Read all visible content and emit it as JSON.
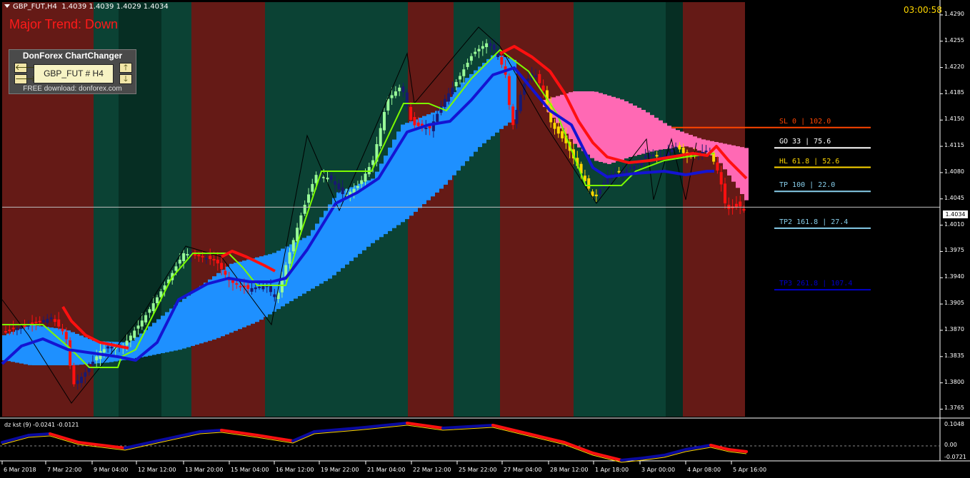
{
  "header": {
    "symbol_line": "GBP_FUT,H4  1.4039 1.4039 1.4029 1.4034",
    "countdown": "03:00:58",
    "trend_text": "Major Trend: Down"
  },
  "widget": {
    "title": "DonForex ChartChanger",
    "symbol_button": "GBP_FUT # H4",
    "footer": "FREE download:  donforex.com",
    "left_up": "🡐",
    "left_down": "🡒",
    "right_up": "🡑",
    "right_down": "🡓"
  },
  "fib_levels": [
    {
      "label": "SL  0      | 102.0",
      "color": "#ff4500",
      "price": 1.414
    },
    {
      "label": "GO  33     | 75.6",
      "color": "#ffffff",
      "price": 1.4113
    },
    {
      "label": "HL  61.8   | 52.6",
      "color": "#ffd700",
      "price": 1.4087
    },
    {
      "label": "TP  100    | 22.0",
      "color": "#87ceeb",
      "price": 1.4055
    },
    {
      "label": "TP2  161.8  | 27.4",
      "color": "#87ceeb",
      "price": 1.4006
    },
    {
      "label": "TP3  261.8  | 107.4",
      "color": "#0000cd",
      "price": 1.3924
    }
  ],
  "y_axis": {
    "ticks": [
      "1.4290",
      "1.4255",
      "1.4220",
      "1.4185",
      "1.4150",
      "1.4115",
      "1.4080",
      "1.4045",
      "1.4010",
      "1.3975",
      "1.3940",
      "1.3905",
      "1.3870",
      "1.3835",
      "1.3800",
      "1.3765"
    ],
    "current_price": "1.4034"
  },
  "x_axis": {
    "ticks": [
      "6 Mar 2018",
      "7 Mar 22:00",
      "9 Mar 04:00",
      "12 Mar 12:00",
      "13 Mar 20:00",
      "15 Mar 04:00",
      "16 Mar 12:00",
      "19 Mar 22:00",
      "21 Mar 04:00",
      "22 Mar 12:00",
      "25 Mar 22:00",
      "27 Mar 04:00",
      "28 Mar 12:00",
      "1 Apr 18:00",
      "3 Apr 00:00",
      "4 Apr 08:00",
      "5 Apr 16:00"
    ]
  },
  "indicator": {
    "label": "dz kst (9) -0.0241 -0.0121",
    "ticks": [
      "0.1048",
      "0.00",
      "-0.0721"
    ]
  },
  "colors": {
    "bear_zone": "#651a16",
    "bull_zone": "#0b4234",
    "bull_zone_dark": "#062e23",
    "cloud_blue": "#1e90ff",
    "cloud_pink": "#ff69b4",
    "ma_blue": "#1414d2",
    "ma_red": "#ff1010"
  }
}
